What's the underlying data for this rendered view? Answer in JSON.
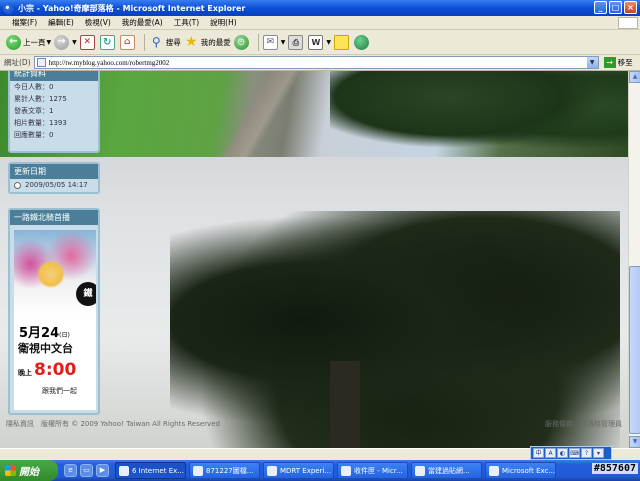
{
  "window": {
    "title": "小宗 - Yahoo!奇摩部落格 - Microsoft Internet Explorer"
  },
  "menu": [
    "檔案(F)",
    "編輯(E)",
    "檢視(V)",
    "我的最愛(A)",
    "工具(T)",
    "說明(H)"
  ],
  "toolbar": {
    "back_label": "上一頁",
    "search_label": "搜尋",
    "favorites_label": "我的最愛"
  },
  "address": {
    "label": "網址(D)",
    "url": "http://tw.myblog.yahoo.com/robertmg2002",
    "go_label": "移至"
  },
  "blog": {
    "stats": {
      "title": "統計資料",
      "rows": [
        "今日人數：0",
        "累計人數：1275",
        "發表文章：1",
        "相片數量：1393",
        "回應數量：0"
      ]
    },
    "updated": {
      "title": "更新日期",
      "date": "2009/05/05 14:17"
    },
    "promo": {
      "title": "一路鐵北騎首播",
      "date": "5月24",
      "date_suffix": "(日)",
      "channel": "衛視中文台",
      "time_prefix": "晚上",
      "time": "8:00",
      "cta": "跟我們一起",
      "logo_text": "鐵"
    },
    "footer_left": "隱私資訊　版權所有 © 2009 Yahoo! Taiwan All Rights Reserved",
    "footer_right": "服務條款　部落格管理員"
  },
  "taskbar": {
    "start_label": "開始",
    "tasks": [
      "6 Internet Ex...",
      "871227圖檔...",
      "MDRT Experi...",
      "收件匣 - Micr...",
      "當建過貼網...",
      "Microsoft Exc..."
    ]
  },
  "watermark": "#857607"
}
